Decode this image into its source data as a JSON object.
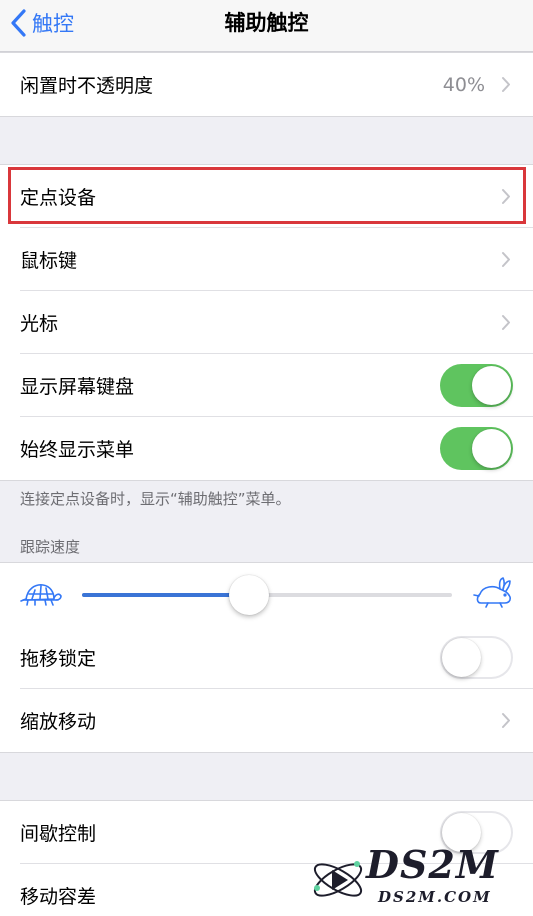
{
  "nav": {
    "back_label": "触控",
    "title": "辅助触控"
  },
  "rows": {
    "idle_opacity": {
      "label": "闲置时不透明度",
      "value": "40%"
    },
    "pointer_devices": {
      "label": "定点设备"
    },
    "mouse_keys": {
      "label": "鼠标键"
    },
    "cursor": {
      "label": "光标"
    },
    "show_keyboard": {
      "label": "显示屏幕键盘",
      "on": true
    },
    "always_show_menu": {
      "label": "始终显示菜单",
      "on": true
    },
    "drag_lock": {
      "label": "拖移锁定",
      "on": false
    },
    "zoom_pan": {
      "label": "缩放移动"
    },
    "dwell_control": {
      "label": "间歇控制",
      "on": false
    },
    "movement_tolerance": {
      "label": "移动容差"
    }
  },
  "footnote": "连接定点设备时，显示“辅助触控”菜单。",
  "tracking": {
    "header": "跟踪速度",
    "value": 0.45,
    "slow_icon": "turtle-icon",
    "fast_icon": "rabbit-icon"
  },
  "watermark": {
    "logo_text": "DS2M",
    "url": "DS2M.COM"
  },
  "colors": {
    "accent": "#3478f6",
    "toggle_on": "#5fc45f",
    "highlight": "#d9373b",
    "slider_fill": "#3a74d6"
  }
}
